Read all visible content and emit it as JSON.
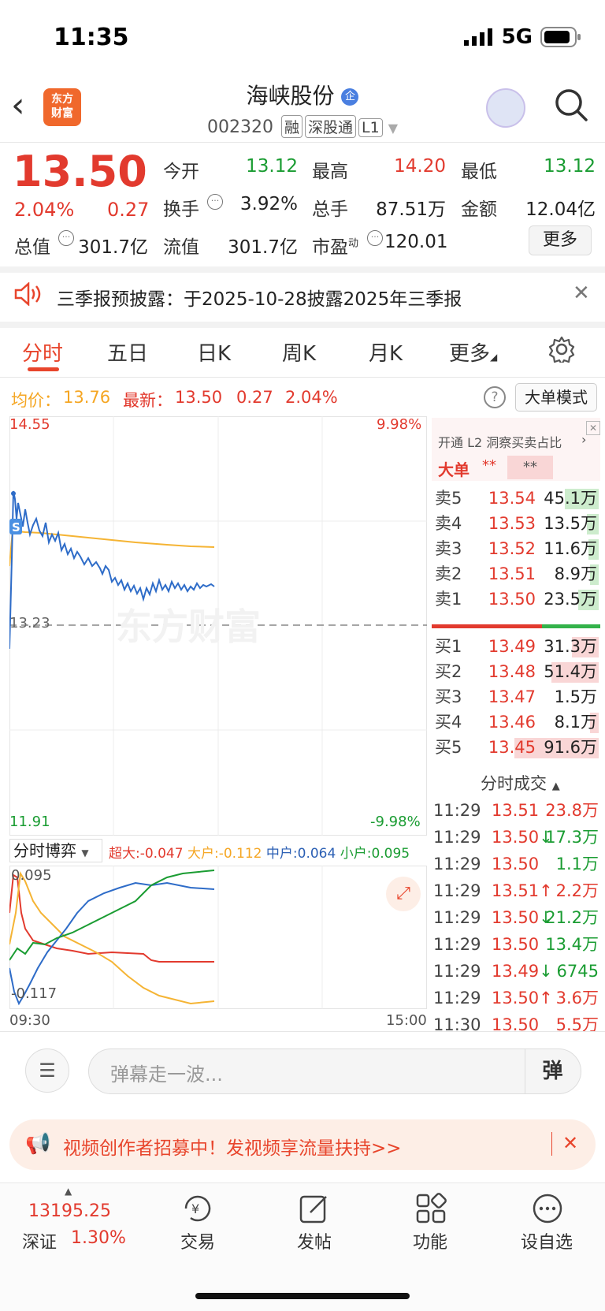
{
  "status": {
    "time": "11:35",
    "network": "5G"
  },
  "header": {
    "logo_top": "东方",
    "logo_bottom": "财富",
    "stock_name": "海峡股份",
    "badge": "企",
    "code": "002320",
    "tags": [
      "融",
      "深股通",
      "L1"
    ]
  },
  "quote": {
    "price": "13.50",
    "pct": "2.04%",
    "change": "0.27",
    "fields": [
      {
        "label": "今开",
        "value": "13.12",
        "color": "green"
      },
      {
        "label": "最高",
        "value": "14.20",
        "color": "red"
      },
      {
        "label": "最低",
        "value": "13.12",
        "color": "green"
      },
      {
        "label": "换手",
        "value": "3.92%",
        "color": "black"
      },
      {
        "label": "总手",
        "value": "87.51万",
        "color": "black"
      },
      {
        "label": "金额",
        "value": "12.04亿",
        "color": "black"
      },
      {
        "label": "总值",
        "value": "301.7亿",
        "color": "black"
      },
      {
        "label": "流值",
        "value": "301.7亿",
        "color": "black"
      },
      {
        "label": "市盈",
        "sup": "动",
        "value": "120.01",
        "color": "black"
      }
    ],
    "more": "更多"
  },
  "notice": "三季报预披露：于2025-10-28披露2025年三季报",
  "tabs": [
    "分时",
    "五日",
    "日K",
    "周K",
    "月K",
    "更多"
  ],
  "summary": {
    "avg_label": "均价：",
    "avg": "13.76",
    "latest_label": "最新：",
    "latest": "13.50",
    "change": "0.27",
    "pct": "2.04%",
    "big_mode": "大单模式"
  },
  "chart": {
    "y_top": "14.55",
    "y_mid": "13.23",
    "y_bottom": "11.91",
    "pct_top": "9.98%",
    "pct_bottom": "-9.98%",
    "watermark": "东方财富",
    "s_mark": "S"
  },
  "flow": {
    "selector": "分时博弈",
    "items": [
      {
        "label": "超大:",
        "value": "-0.047",
        "color": "#e23a2e"
      },
      {
        "label": "大户:",
        "value": "-0.112",
        "color": "#f5a623"
      },
      {
        "label": "中户:",
        "value": "0.064",
        "color": "#2b5fb4"
      },
      {
        "label": "小户:",
        "value": "0.095",
        "color": "#1a9c32"
      }
    ],
    "y_top": "0.095",
    "y_bottom": "-0.117",
    "x_start": "09:30",
    "x_end": "15:00"
  },
  "orderbook": {
    "l2_text": "开通 L2 洞察买卖占比",
    "bigorder": "大单",
    "stars1": "**",
    "stars2": "**",
    "sells": [
      {
        "label": "卖5",
        "price": "13.54",
        "vol": "45.1万",
        "bar": 0.2
      },
      {
        "label": "卖4",
        "price": "13.53",
        "vol": "13.5万",
        "bar": 0.07
      },
      {
        "label": "卖3",
        "price": "13.52",
        "vol": "11.6万",
        "bar": 0.06
      },
      {
        "label": "卖2",
        "price": "13.51",
        "vol": "8.9万",
        "bar": 0.05
      },
      {
        "label": "卖1",
        "price": "13.50",
        "vol": "23.5万",
        "bar": 0.12
      }
    ],
    "buys": [
      {
        "label": "买1",
        "price": "13.49",
        "vol": "31.3万",
        "bar": 0.16
      },
      {
        "label": "买2",
        "price": "13.48",
        "vol": "51.4万",
        "bar": 0.28
      },
      {
        "label": "买3",
        "price": "13.47",
        "vol": "1.5万",
        "bar": 0.0
      },
      {
        "label": "买4",
        "price": "13.46",
        "vol": "8.1万",
        "bar": 0.05
      },
      {
        "label": "买5",
        "price": "13.45",
        "vol": "91.6万",
        "bar": 0.5
      }
    ]
  },
  "trades": {
    "title": "分时成交",
    "rows": [
      {
        "time": "11:29",
        "price": "13.51",
        "vol": "23.8万",
        "arrow": "",
        "vcolor": "red"
      },
      {
        "time": "11:29",
        "price": "13.50",
        "vol": "17.3万",
        "arrow": "↓",
        "vcolor": "green"
      },
      {
        "time": "11:29",
        "price": "13.50",
        "vol": "1.1万",
        "arrow": "",
        "vcolor": "green"
      },
      {
        "time": "11:29",
        "price": "13.51",
        "vol": "2.2万",
        "arrow": "↑",
        "vcolor": "red"
      },
      {
        "time": "11:29",
        "price": "13.50",
        "vol": "21.2万",
        "arrow": "↓",
        "vcolor": "green"
      },
      {
        "time": "11:29",
        "price": "13.50",
        "vol": "13.4万",
        "arrow": "",
        "vcolor": "green"
      },
      {
        "time": "11:29",
        "price": "13.49",
        "vol": "6745",
        "arrow": "↓",
        "vcolor": "green"
      },
      {
        "time": "11:29",
        "price": "13.50",
        "vol": "3.6万",
        "arrow": "↑",
        "vcolor": "red"
      },
      {
        "time": "11:30",
        "price": "13.50",
        "vol": "5.5万",
        "arrow": "",
        "vcolor": "red"
      }
    ]
  },
  "danmu": {
    "placeholder": "弹幕走一波...",
    "send": "弹"
  },
  "banner": "视频创作者招募中！发视频享流量扶持>>",
  "nav": {
    "index_value": "13195.25",
    "index_name": "深证",
    "index_pct": "1.30%",
    "items": [
      "交易",
      "发帖",
      "功能",
      "设自选"
    ]
  }
}
